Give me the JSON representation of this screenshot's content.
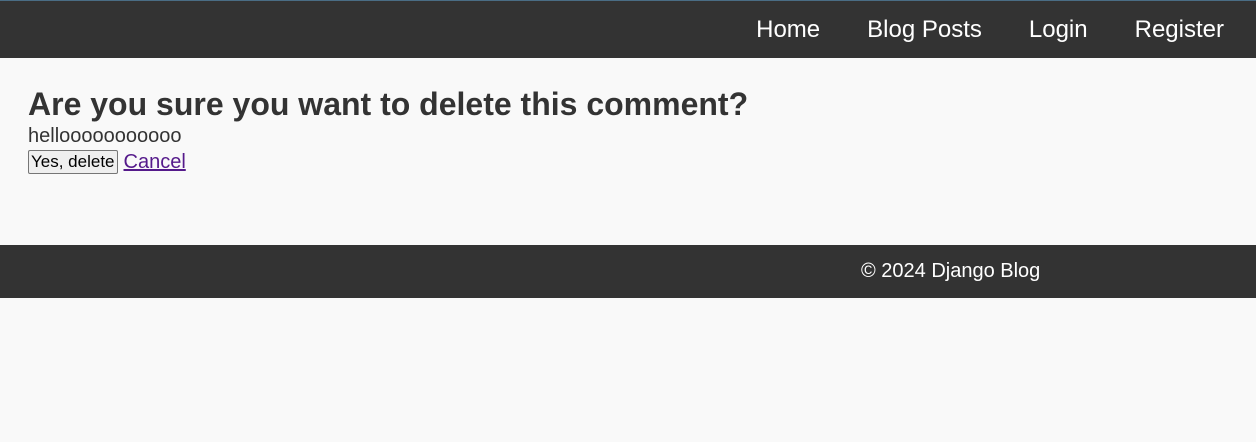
{
  "nav": {
    "items": [
      {
        "label": "Home"
      },
      {
        "label": "Blog Posts"
      },
      {
        "label": "Login"
      },
      {
        "label": "Register"
      }
    ]
  },
  "main": {
    "heading": "Are you sure you want to delete this comment?",
    "comment_text": "hellooooooooooo",
    "confirm_label": "Yes, delete",
    "cancel_label": "Cancel"
  },
  "footer": {
    "text": "© 2024 Django Blog"
  },
  "colors": {
    "bar": "#333333",
    "background": "#f9f9f9",
    "visited_link": "#551a8b"
  }
}
